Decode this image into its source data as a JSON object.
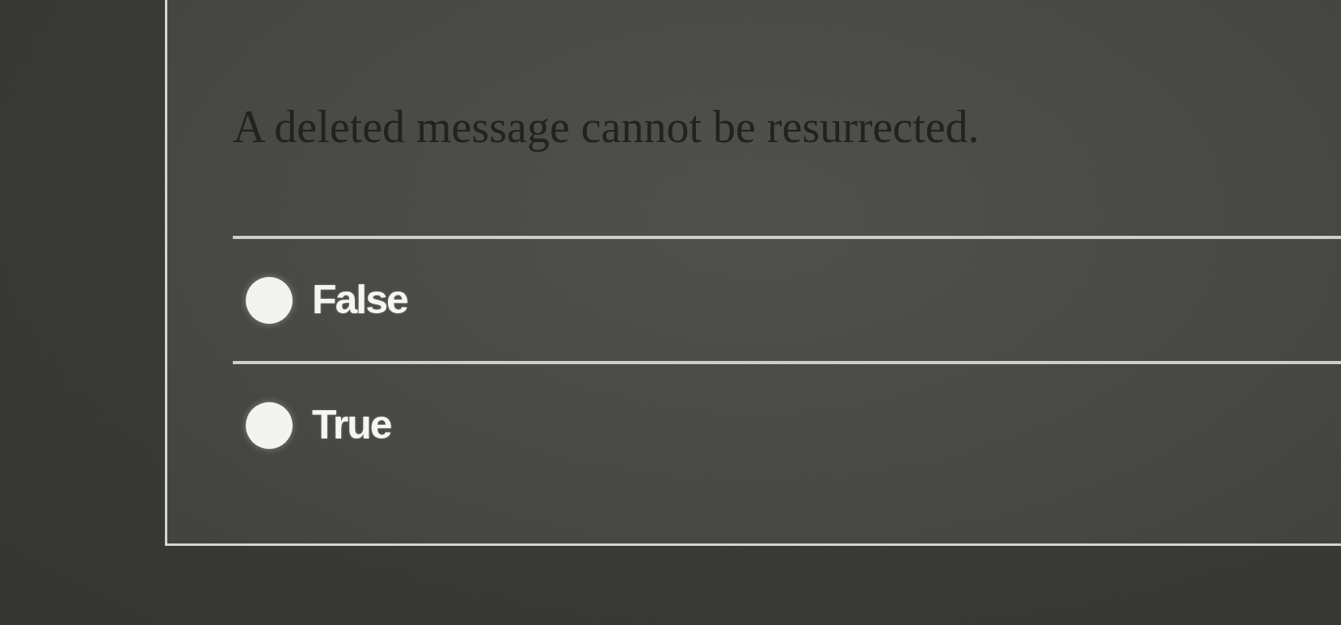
{
  "question": {
    "text": "A deleted message cannot be resurrected."
  },
  "options": [
    {
      "label": "False",
      "selected": false
    },
    {
      "label": "True",
      "selected": false
    }
  ]
}
